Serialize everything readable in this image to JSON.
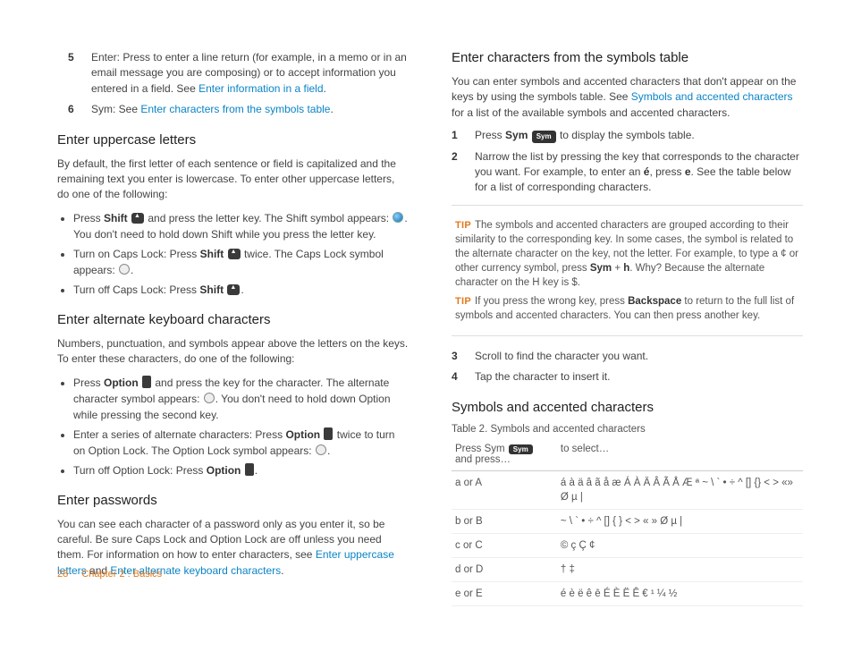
{
  "left": {
    "n5": {
      "num": "5",
      "label": "Enter:",
      "text1": " Press to enter a line return (for example, in a memo or in an email message you are composing) or to accept information you entered in a field. See ",
      "link": "Enter information in a field",
      "text2": "."
    },
    "n6": {
      "num": "6",
      "label": "Sym:",
      "text1": " See ",
      "link": "Enter characters from the symbols table",
      "text2": "."
    },
    "h_upper": "Enter uppercase letters",
    "p_upper": "By default, the first letter of each sentence or field is capitalized and the remaining text you enter is lowercase. To enter other uppercase letters, do one of the following:",
    "u1a": "Press ",
    "u1b": "Shift",
    "u1c": " and press the letter key. The Shift symbol appears: ",
    "u1d": ". You don't need to hold down Shift while you press the letter key.",
    "u2a": "Turn on Caps Lock: Press ",
    "u2b": "Shift",
    "u2c": " twice. The Caps Lock symbol appears: ",
    "u2d": ".",
    "u3a": "Turn off Caps Lock: Press ",
    "u3b": "Shift",
    "u3c": ".",
    "h_alt": "Enter alternate keyboard characters",
    "p_alt": "Numbers, punctuation, and symbols appear above the letters on the keys. To enter these characters, do one of the following:",
    "a1a": "Press ",
    "a1b": "Option",
    "a1c": " and press the key for the character. The alternate character symbol appears: ",
    "a1d": ". You don't need to hold down Option while pressing the second key.",
    "a2a": "Enter a series of alternate characters: Press ",
    "a2b": "Option",
    "a2c": " twice to turn on Option Lock. The Option Lock symbol appears: ",
    "a2d": ".",
    "a3a": "Turn off Option Lock: Press ",
    "a3b": "Option",
    "a3c": ".",
    "h_pw": "Enter passwords",
    "pw1": "You can see each character of a password only as you enter it, so be careful. Be sure Caps Lock and Option Lock are off unless you need them. For information on how to enter characters, see ",
    "pwlink1": "Enter uppercase letters",
    "pwand": " and ",
    "pwlink2": "Enter alternate keyboard characters",
    "pwend": "."
  },
  "right": {
    "h_symtab": "Enter characters from the symbols table",
    "p_st1": "You can enter symbols and accented characters that don't appear on the keys by using the symbols table. See ",
    "p_st_link": "Symbols and accented characters",
    "p_st2": " for a list of the available symbols and accented characters.",
    "s1": {
      "num": "1",
      "a": "Press ",
      "b": "Sym",
      "c": " to display the symbols table."
    },
    "s2": {
      "num": "2",
      "a": "Narrow the list by pressing the key that corresponds to the character you want. For example, to enter an ",
      "b": "é",
      "c": ", press ",
      "d": "e",
      "e": ". See the table below for a list of corresponding characters."
    },
    "tip1a": "The symbols and accented characters are grouped according to their similarity to the corresponding key. In some cases, the symbol is related to the alternate character on the key, not the letter. For example, to type a ¢ or other currency symbol, press ",
    "tip1b": "Sym",
    "tip1c": " + ",
    "tip1d": "h",
    "tip1e": ". Why? Because the alternate character on the H key is $.",
    "tip2a": "If you press the wrong key, press ",
    "tip2b": "Backspace",
    "tip2c": " to return to the full list of symbols and accented characters. You can then press another key.",
    "s3": {
      "num": "3",
      "a": "Scroll to find the character you want."
    },
    "s4": {
      "num": "4",
      "a": "Tap the character to insert it."
    },
    "h_chars": "Symbols and accented characters",
    "table_caption": "Table 2.  Symbols and accented characters",
    "th1a": "Press Sym ",
    "th1b": " and press…",
    "th2": "to select…",
    "rows": {
      "r0a": "a or A",
      "r0b": "á à ä â ã å æ Á À Ä Â Ã Å Æ ª ~ \\ ` • ÷ ^ [] {} < > «» Ø µ |",
      "r1a": "b or B",
      "r1b": "~ \\ ` • ÷ ^ [] { } < > « » Ø µ |",
      "r2a": "c or C",
      "r2b": "© ç Ç ¢",
      "r3a": "d or D",
      "r3b": "† ‡",
      "r4a": "e or E",
      "r4b": "é è ë ê ē É È Ë Ê € ¹ ¼ ½"
    }
  },
  "footer": {
    "page": "28",
    "chapter": "Chapter 2  :  Basics"
  },
  "tip_label": "TIP",
  "sym_label": "Sym"
}
